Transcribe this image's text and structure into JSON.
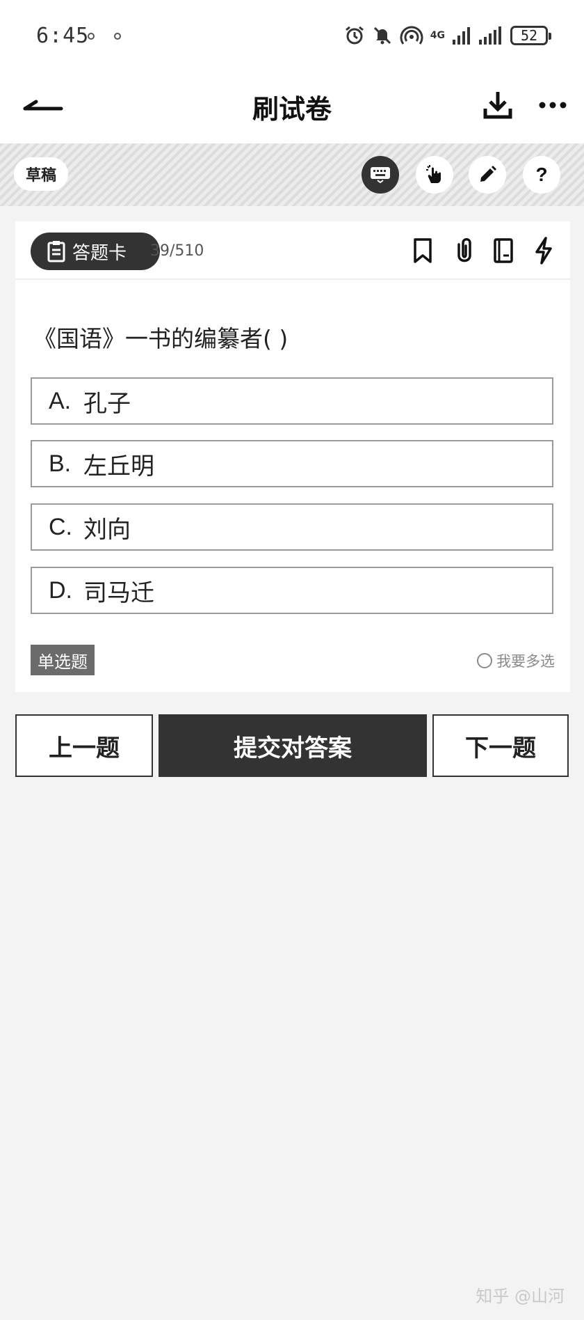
{
  "status_bar": {
    "time": "6:45",
    "network": "4G",
    "battery": "52"
  },
  "header": {
    "title": "刷试卷"
  },
  "toolbar": {
    "draft_label": "草稿"
  },
  "card": {
    "answer_card_label": "答题卡",
    "progress": "39/510",
    "question": "《国语》一书的编纂者( )",
    "options": [
      {
        "letter": "A.",
        "text": "孔子"
      },
      {
        "letter": "B.",
        "text": "左丘明"
      },
      {
        "letter": "C.",
        "text": "刘向"
      },
      {
        "letter": "D.",
        "text": "司马迁"
      }
    ],
    "question_type": "单选题",
    "multi_select_label": "我要多选"
  },
  "actions": {
    "prev_label": "上一题",
    "submit_label": "提交对答案",
    "next_label": "下一题"
  },
  "watermark": "知乎 @山河",
  "colors": {
    "dark": "#333333",
    "background": "#f3f3f3",
    "badge": "#6b6b6b"
  }
}
